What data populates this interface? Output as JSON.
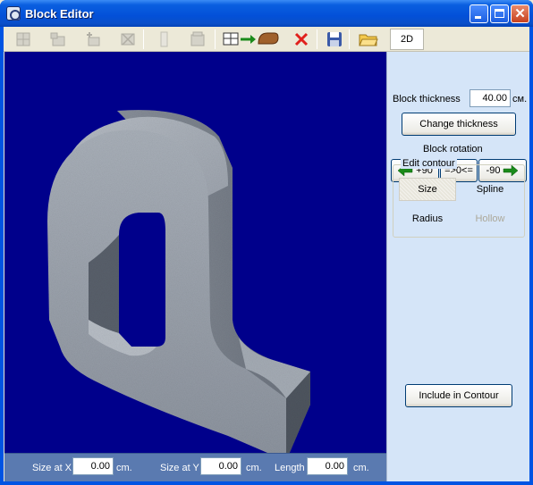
{
  "window": {
    "title": "Block Editor"
  },
  "toolbar": {
    "items": [
      "grid-icon",
      "add-layer-icon",
      "add-block-icon",
      "delete-block-icon",
      "column-icon",
      "layer-icon",
      "export-shape-icon",
      "delete-icon",
      "save-icon",
      "open-folder-icon"
    ],
    "view_2d_label": "2D"
  },
  "status": {
    "size_x_label": "Size at X",
    "size_x_value": "0.00",
    "size_y_label": "Size at Y",
    "size_y_value": "0.00",
    "length_label": "Length",
    "length_value": "0.00",
    "unit": "cm."
  },
  "panel": {
    "thickness_label": "Block thickness",
    "thickness_value": "40.00",
    "thickness_unit": "cм.",
    "change_thickness": "Change thickness",
    "rotation_label": "Block rotation",
    "rot_plus": "+90",
    "rot_zero": "=>0<=",
    "rot_minus": "-90",
    "contour_group": "Edit contour",
    "opt_size": "Size",
    "opt_spline": "Spline",
    "opt_radius": "Radius",
    "opt_hollow": "Hollow",
    "include": "Include in Contour"
  },
  "colors": {
    "viewport": "#00008b",
    "titlebar": "#0350d8",
    "panel": "#d5e5f8",
    "status": "#5a7ab0"
  }
}
